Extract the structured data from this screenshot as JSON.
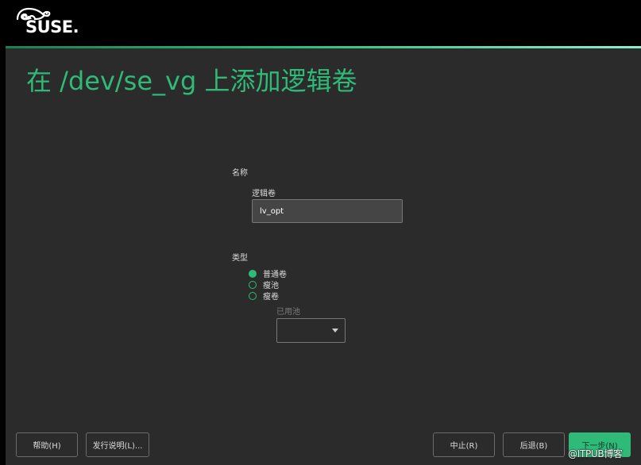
{
  "header": {
    "logo_text": "SUSE",
    "logo_dot": "."
  },
  "page": {
    "title": "在 /dev/se_vg 上添加逻辑卷"
  },
  "name_section": {
    "label": "名称",
    "field_label": "逻辑卷",
    "field_value": "lv_opt"
  },
  "type_section": {
    "label": "类型",
    "options": [
      {
        "label": "普通卷",
        "checked": true
      },
      {
        "label": "瘦池",
        "checked": false
      },
      {
        "label": "瘦卷",
        "checked": false
      }
    ],
    "pool_label": "已用池",
    "pool_value": ""
  },
  "buttons": {
    "help": "帮助(H)",
    "release_notes": "发行说明(L)...",
    "abort": "中止(R)",
    "back": "后退(B)",
    "next": "下一步(N)"
  },
  "watermark": "@ITPUB博客",
  "colors": {
    "accent": "#30ba78",
    "background": "#2b2b2b",
    "header": "#000000"
  },
  "icons": {
    "logo": "suse-chameleon-icon",
    "dropdown": "chevron-down-icon"
  }
}
